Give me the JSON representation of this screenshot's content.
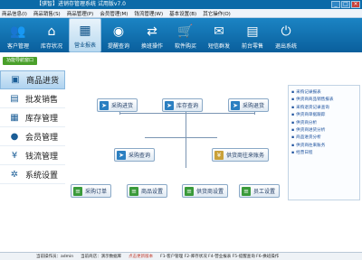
{
  "window": {
    "title": "【骐智】进销存管理系统  试用版v7.0"
  },
  "menubar": [
    "商品信息(I)",
    "商品销售(S)",
    "商品管理(P)",
    "会员管理(M)",
    "钱流管理(W)",
    "基本设置(B)",
    "其它操作(O)"
  ],
  "toolbar": [
    {
      "label": "客户管理",
      "icon": "user-icon"
    },
    {
      "label": "库存状况",
      "icon": "home-icon"
    },
    {
      "label": "营业报表",
      "icon": "calendar-icon"
    },
    {
      "label": "提醒查询",
      "icon": "eye-icon"
    },
    {
      "label": "换班操作",
      "icon": "swap-icon"
    },
    {
      "label": "软件购买",
      "icon": "cart-icon"
    },
    {
      "label": "短信群发",
      "icon": "mail-icon"
    },
    {
      "label": "前台零售",
      "icon": "register-icon"
    },
    {
      "label": "退出系统",
      "icon": "exit-icon"
    }
  ],
  "nav_tag": "功能导航窗口",
  "sidebar": [
    {
      "label": "商品进货",
      "icon": "box-icon"
    },
    {
      "label": "批发销售",
      "icon": "doc-icon"
    },
    {
      "label": "库存管理",
      "icon": "grid-icon"
    },
    {
      "label": "会员管理",
      "icon": "person-icon"
    },
    {
      "label": "钱流管理",
      "icon": "yen-icon"
    },
    {
      "label": "系统设置",
      "icon": "gear-icon"
    }
  ],
  "flow": {
    "purchase_in": "采购进货",
    "stock_query": "库存查询",
    "purchase_return": "采购退货",
    "purchase_query": "采购查询",
    "supplier_account": "供货商往来账务",
    "purchase_order": "采购订单",
    "product_settings": "商品设置",
    "supplier_settings": "供货商设置",
    "staff_settings": "员工设置"
  },
  "right_panel": [
    "采购记录报表",
    "供货商商品销售报表",
    "采购退货记录查询",
    "供货商单据跟踪",
    "供货商分析",
    "供货商进货分析",
    "商品进货分析",
    "供货商往来账务",
    "经营日程"
  ],
  "status": {
    "operator": "当前操作员：admin",
    "shop": "当前商店：演示数据库",
    "link": "点击更新版本",
    "shortcuts": "F1-客户管理  F2-库存状况  F4-营业报表  F5-提醒查询  F6-换班操作"
  }
}
